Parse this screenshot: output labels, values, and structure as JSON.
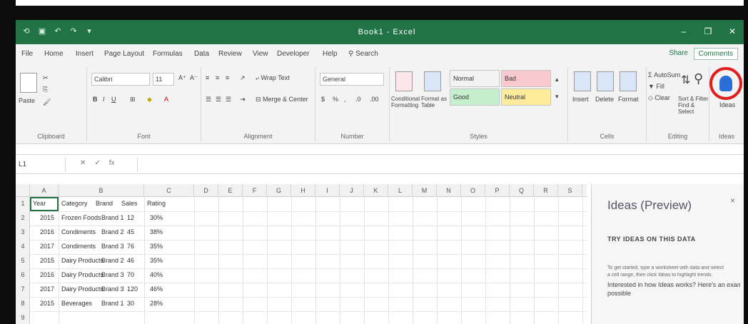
{
  "titlebar": {
    "doc_title": "Book1 - Excel",
    "qat_icons": [
      "autosave-icon",
      "save-icon",
      "undo-icon",
      "redo-icon",
      "customize-icon"
    ],
    "controls": [
      "minimize-icon",
      "restore-icon",
      "close-icon"
    ]
  },
  "tabs": {
    "items": [
      "File",
      "Home",
      "Insert",
      "Page Layout",
      "Formulas",
      "Data",
      "Review",
      "View",
      "Developer",
      "Help"
    ],
    "search": "Search",
    "share": "Share",
    "comments": "Comments"
  },
  "ribbon": {
    "clipboard": {
      "label": "Clipboard",
      "paste": "Paste"
    },
    "font": {
      "label": "Font",
      "font_name": "Calibri",
      "font_size": "11"
    },
    "alignment": {
      "label": "Alignment",
      "wrap": "Wrap Text",
      "merge": "Merge & Center"
    },
    "number": {
      "label": "Number",
      "format": "General"
    },
    "styles": {
      "label": "Styles",
      "conditional": "Conditional Formatting",
      "format_table": "Format as Table",
      "cells": [
        {
          "name": "Normal",
          "bg": "#ffffff"
        },
        {
          "name": "Bad",
          "bg": "#f8c9cf"
        },
        {
          "name": "Good",
          "bg": "#c6efce"
        },
        {
          "name": "Neutral",
          "bg": "#ffeb9c"
        }
      ]
    },
    "cells_group": {
      "label": "Cells",
      "insert": "Insert",
      "delete": "Delete",
      "format": "Format"
    },
    "editing": {
      "label": "Editing",
      "autosum": "AutoSum",
      "fill": "Fill",
      "clear": "Clear",
      "sort": "Sort & Filter",
      "find": "Find & Select"
    },
    "ideas": {
      "label": "Ideas",
      "button": "Ideas"
    }
  },
  "formula_bar": {
    "name_box": "L1",
    "fx": [
      "cancel-icon",
      "enter-icon",
      "fx-icon"
    ]
  },
  "grid": {
    "columns": [
      "A",
      "B",
      "C",
      "D",
      "E",
      "F",
      "G",
      "H",
      "I",
      "J",
      "K",
      "L",
      "M",
      "N",
      "O",
      "P",
      "Q",
      "R",
      "S"
    ],
    "rows": [
      "1",
      "2",
      "3",
      "4",
      "5",
      "6",
      "7",
      "8",
      "9"
    ],
    "header_cells": [
      "Year",
      "Category",
      "Brand",
      "Sales",
      "Rating"
    ],
    "data": [
      [
        "2015",
        "Frozen Foods",
        "Brand 1",
        "12",
        "30%"
      ],
      [
        "2016",
        "Condiments",
        "Brand 2",
        "45",
        "38%"
      ],
      [
        "2017",
        "Condiments",
        "Brand 3",
        "76",
        "35%"
      ],
      [
        "2015",
        "Dairy Products",
        "Brand 2",
        "46",
        "35%"
      ],
      [
        "2016",
        "Dairy Products",
        "Brand 3",
        "70",
        "40%"
      ],
      [
        "2017",
        "Dairy Products",
        "Brand 3",
        "120",
        "46%"
      ],
      [
        "2015",
        "Beverages",
        "Brand 1",
        "30",
        "28%"
      ]
    ]
  },
  "ideas_pane": {
    "title": "Ideas (Preview)",
    "close": "×",
    "line1": "TRY IDEAS ON THIS DATA",
    "line2": "To get started, type a worksheet with data and select",
    "line3": "a cell range, then click Ideas to highlight trends.",
    "line4": "Interested in how Ideas works? Here's an example of what's",
    "line5": "possible"
  }
}
